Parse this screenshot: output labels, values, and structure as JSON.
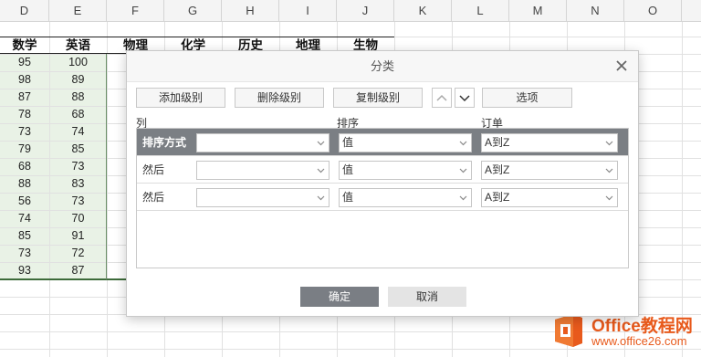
{
  "sheet": {
    "columns": [
      "D",
      "E",
      "F",
      "G",
      "H",
      "I",
      "J",
      "K",
      "L",
      "M",
      "N",
      "O"
    ],
    "header_row": [
      "数学",
      "英语",
      "物理",
      "化学",
      "历史",
      "地理",
      "生物"
    ],
    "math": [
      "95",
      "98",
      "87",
      "78",
      "73",
      "79",
      "68",
      "88",
      "56",
      "74",
      "85",
      "73",
      "93"
    ],
    "english": [
      "100",
      "89",
      "88",
      "68",
      "74",
      "85",
      "73",
      "83",
      "73",
      "70",
      "91",
      "72",
      "87"
    ]
  },
  "dialog": {
    "title": "分类",
    "buttons": {
      "add_level": "添加级别",
      "delete_level": "删除级别",
      "copy_level": "复制级别",
      "options": "选项"
    },
    "headers": {
      "column": "列",
      "sort_on": "排序",
      "order": "订单"
    },
    "rows": [
      {
        "label": "排序方式",
        "column_value": "",
        "sort_on": "值",
        "order": "A到Z"
      },
      {
        "label": "然后",
        "column_value": "",
        "sort_on": "值",
        "order": "A到Z"
      },
      {
        "label": "然后",
        "column_value": "",
        "sort_on": "值",
        "order": "A到Z"
      }
    ],
    "ok_label": "确定",
    "cancel_label": "取消"
  },
  "watermark": {
    "title": "Office教程网",
    "url": "www.office26.com"
  },
  "colors": {
    "selected_row": "#7b7f84",
    "ok_button": "#7a7e84",
    "watermark": "#e85a1c",
    "data_tint": "#e9f2e6"
  }
}
